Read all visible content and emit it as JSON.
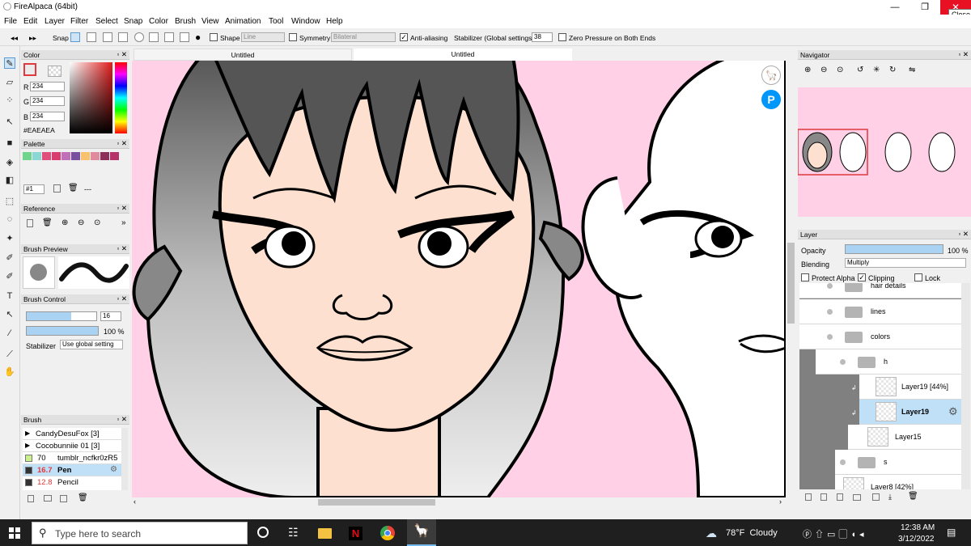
{
  "window": {
    "title": "FireAlpaca (64bit)",
    "close_tooltip": "Close"
  },
  "menu": [
    "File",
    "Edit",
    "Layer",
    "Filter",
    "Select",
    "Snap",
    "Color",
    "Brush",
    "View",
    "Animation",
    "Tool",
    "Window",
    "Help"
  ],
  "toolbar": {
    "snap_label": "Snap",
    "shape_label": "Shape",
    "shape_value": "Line",
    "symmetry_label": "Symmetry",
    "symmetry_value": "Bilateral",
    "antialias_label": "Anti-aliasing",
    "stabilizer_label": "Stabilizer (Global settings)",
    "stabilizer_value": "38",
    "zero_pressure_label": "Zero Pressure on Both Ends"
  },
  "tabs": [
    "Untitled",
    "Untitled"
  ],
  "color_panel": {
    "title": "Color",
    "r_label": "R",
    "r": "234",
    "g_label": "G",
    "g": "234",
    "b_label": "B",
    "b": "234",
    "hex": "#EAEAEA"
  },
  "palette_panel": {
    "title": "Palette",
    "selector": "#1",
    "more": "---",
    "swatches": [
      "#6fd48c",
      "#8ad7d3",
      "#e0507c",
      "#d93c6e",
      "#c06fb8",
      "#7a4fa0",
      "#f7c26b",
      "#e08aa0",
      "#8c2d5a",
      "#b8326a"
    ]
  },
  "reference_panel": {
    "title": "Reference"
  },
  "brush_preview_panel": {
    "title": "Brush Preview"
  },
  "brush_control_panel": {
    "title": "Brush Control",
    "size": "16",
    "opacity": "100 %",
    "stabilizer_label": "Stabilizer",
    "stabilizer_value": "Use global setting"
  },
  "brush_panel": {
    "title": "Brush",
    "items": [
      {
        "size": "",
        "name": "CandyDesuFox [3]",
        "group": true
      },
      {
        "size": "",
        "name": "Cocobunniie 01 [3]",
        "group": true
      },
      {
        "size": "70",
        "name": "tumblr_ncfkr0zR5",
        "group": false,
        "swatch": "#c9f08a"
      },
      {
        "size": "16.7",
        "name": "Pen",
        "group": false,
        "selected": true,
        "swatch": "#333333"
      },
      {
        "size": "12.8",
        "name": "Pencil",
        "group": false,
        "swatch": "#333333"
      }
    ]
  },
  "navigator_panel": {
    "title": "Navigator"
  },
  "layer_panel": {
    "title": "Layer",
    "opacity_label": "Opacity",
    "opacity_value": "100 %",
    "opacity_fraction": 1.0,
    "blending_label": "Blending",
    "blending_value": "Multiply",
    "protect_alpha": "Protect Alpha",
    "clipping": "Clipping",
    "lock": "Lock",
    "layers": [
      {
        "name": "hair details",
        "type": "folder",
        "indent": 1
      },
      {
        "name": "lines",
        "type": "folder",
        "indent": 1
      },
      {
        "name": "colors",
        "type": "folder",
        "indent": 1
      },
      {
        "name": "h",
        "type": "folder",
        "indent": 2
      },
      {
        "name": "Layer19 [44%]",
        "type": "layer",
        "indent": 3,
        "clip": true
      },
      {
        "name": "Layer19",
        "type": "layer",
        "indent": 3,
        "clip": true,
        "selected": true
      },
      {
        "name": "Layer15",
        "type": "layer",
        "indent": 2
      },
      {
        "name": "s",
        "type": "folder",
        "indent": 2
      },
      {
        "name": "Layer8 [42%]",
        "type": "layer",
        "indent": 1
      }
    ]
  },
  "taskbar": {
    "search_placeholder": "Type here to search",
    "weather": "78°F  Cloudy",
    "time": "12:38 AM",
    "date": "3/12/2022"
  },
  "colors": {
    "canvas_bg": "#ffd0e6",
    "skin": "#fde0cf",
    "selection": "#bfe0f7",
    "accent_red": "#e81123"
  }
}
